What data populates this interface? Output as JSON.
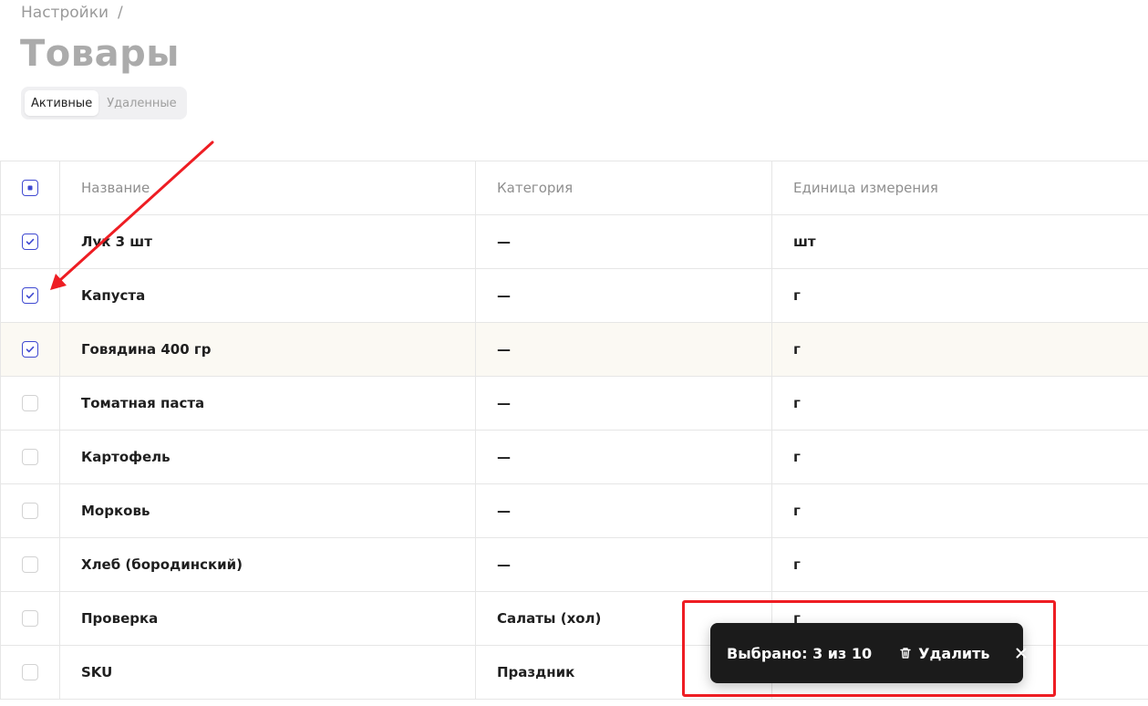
{
  "breadcrumb": {
    "parent": "Настройки",
    "separator": "/"
  },
  "page": {
    "title": "Товары"
  },
  "tabs": [
    {
      "label": "Активные",
      "active": true
    },
    {
      "label": "Удаленные",
      "active": false
    }
  ],
  "table": {
    "headers": {
      "name": "Название",
      "category": "Категория",
      "unit": "Единица измерения"
    },
    "select_all_state": "indeterminate",
    "rows": [
      {
        "name": "Лук 3 шт",
        "category": "—",
        "unit": "шт",
        "checked": true
      },
      {
        "name": "Капуста",
        "category": "—",
        "unit": "г",
        "checked": true
      },
      {
        "name": "Говядина 400 гр",
        "category": "—",
        "unit": "г",
        "checked": true
      },
      {
        "name": "Томатная паста",
        "category": "—",
        "unit": "г",
        "checked": false
      },
      {
        "name": "Картофель",
        "category": "—",
        "unit": "г",
        "checked": false
      },
      {
        "name": "Морковь",
        "category": "—",
        "unit": "г",
        "checked": false
      },
      {
        "name": "Хлеб (бородинский)",
        "category": "—",
        "unit": "г",
        "checked": false
      },
      {
        "name": "Проверка",
        "category": "Салаты (хол)",
        "unit": "г",
        "checked": false
      },
      {
        "name": "SKU",
        "category": "Праздник",
        "unit": "",
        "checked": false
      }
    ]
  },
  "selection_bar": {
    "count_text": "Выбрано: 3 из 10",
    "delete_label": "Удалить",
    "delete_icon": "trash-icon",
    "close_icon": "close-icon"
  },
  "colors": {
    "accent": "#3f49d1",
    "annotation_red": "#ee1d23",
    "toast_bg": "#1b1b1b",
    "row_highlight": "#fbf9f3"
  }
}
